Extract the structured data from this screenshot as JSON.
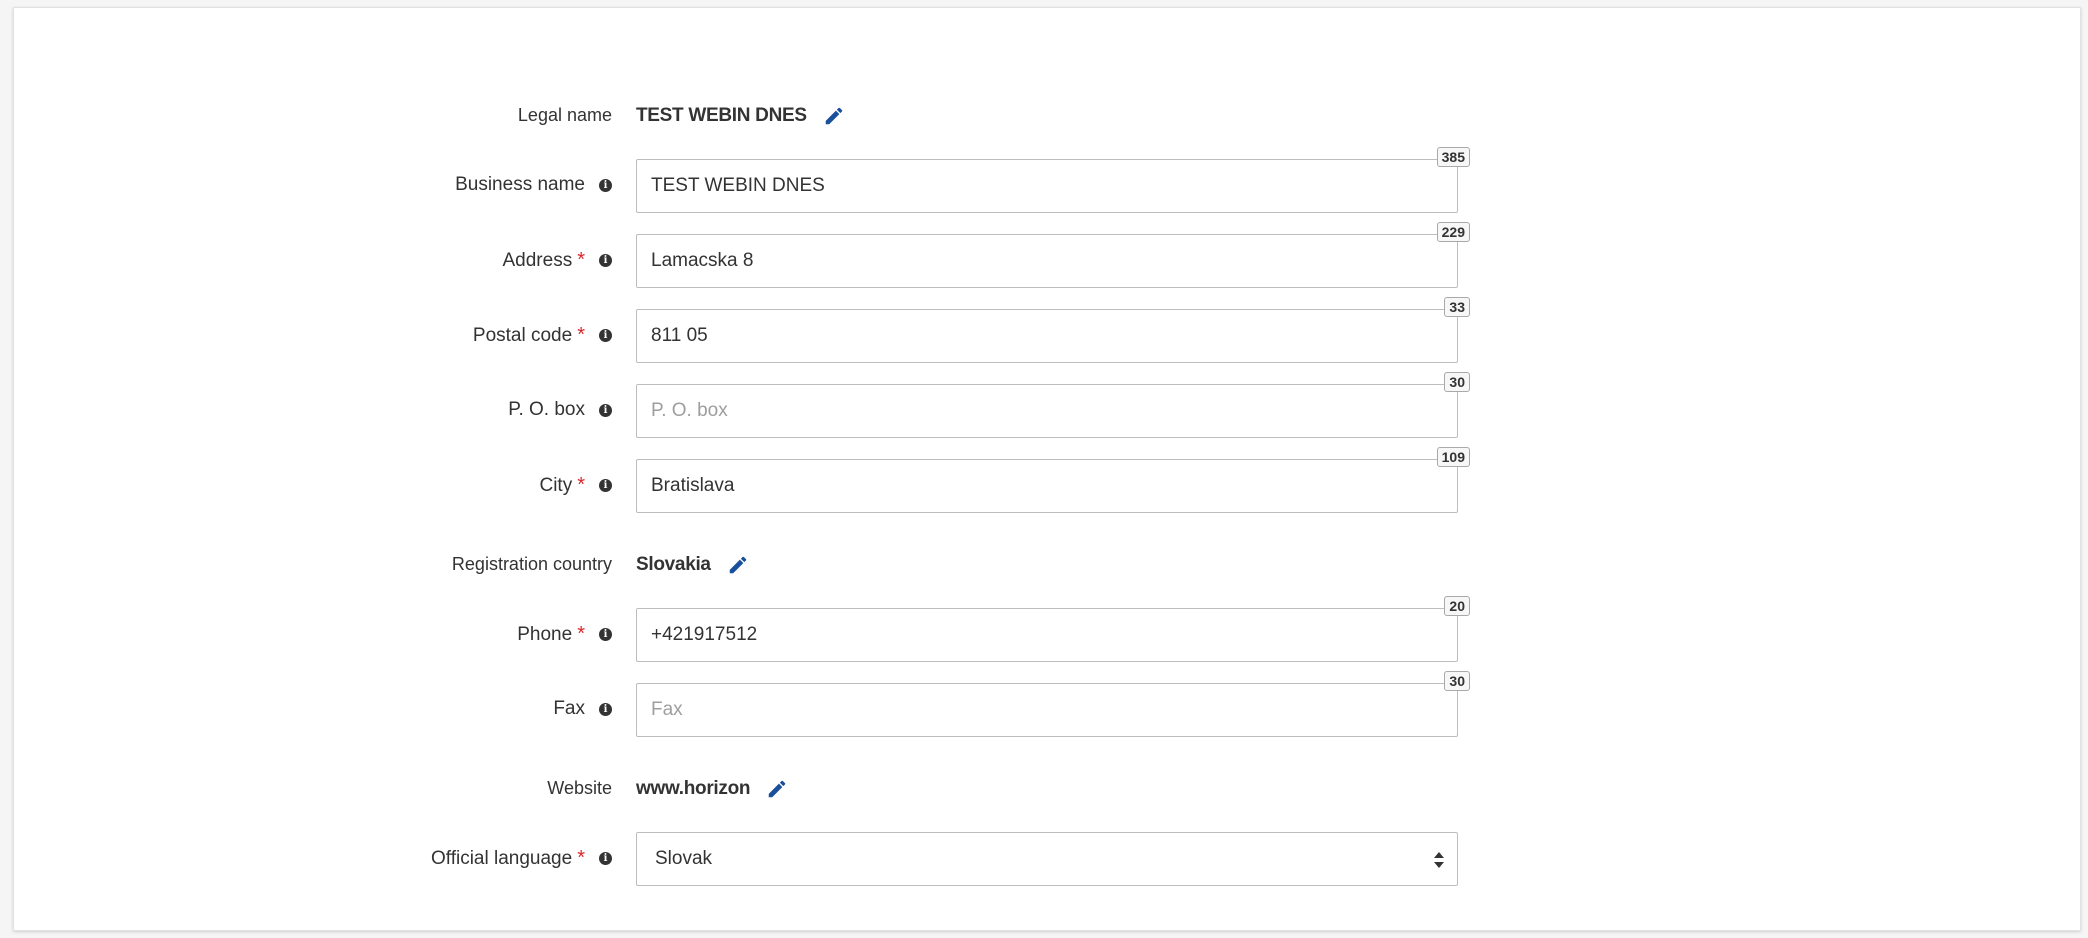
{
  "form": {
    "legal_name": {
      "label": "Legal name",
      "value": "TEST WEBIN DNES"
    },
    "business_name": {
      "label": "Business name",
      "value": "TEST WEBIN DNES",
      "placeholder": "",
      "counter": "385"
    },
    "address": {
      "label": "Address",
      "required_mark": "*",
      "value": "Lamacska 8",
      "placeholder": "",
      "counter": "229"
    },
    "postal_code": {
      "label": "Postal code",
      "required_mark": "*",
      "value": "811 05",
      "placeholder": "",
      "counter": "33"
    },
    "po_box": {
      "label": "P. O. box",
      "value": "",
      "placeholder": "P. O. box",
      "counter": "30"
    },
    "city": {
      "label": "City",
      "required_mark": "*",
      "value": "Bratislava",
      "placeholder": "",
      "counter": "109"
    },
    "registration_country": {
      "label": "Registration country",
      "value": "Slovakia"
    },
    "phone": {
      "label": "Phone",
      "required_mark": "*",
      "value": "+421917512",
      "placeholder": "",
      "counter": "20"
    },
    "fax": {
      "label": "Fax",
      "value": "",
      "placeholder": "Fax",
      "counter": "30"
    },
    "website": {
      "label": "Website",
      "value": "www.horizon"
    },
    "official_language": {
      "label": "Official language",
      "required_mark": "*",
      "selected": "Slovak"
    }
  },
  "icons": {
    "info": "info-icon",
    "edit": "pencil-icon",
    "select_caret": "sort-caret-icon"
  },
  "colors": {
    "required": "#d9262b",
    "edit_icon": "#1a4f9c",
    "border": "#bdbdbd"
  }
}
